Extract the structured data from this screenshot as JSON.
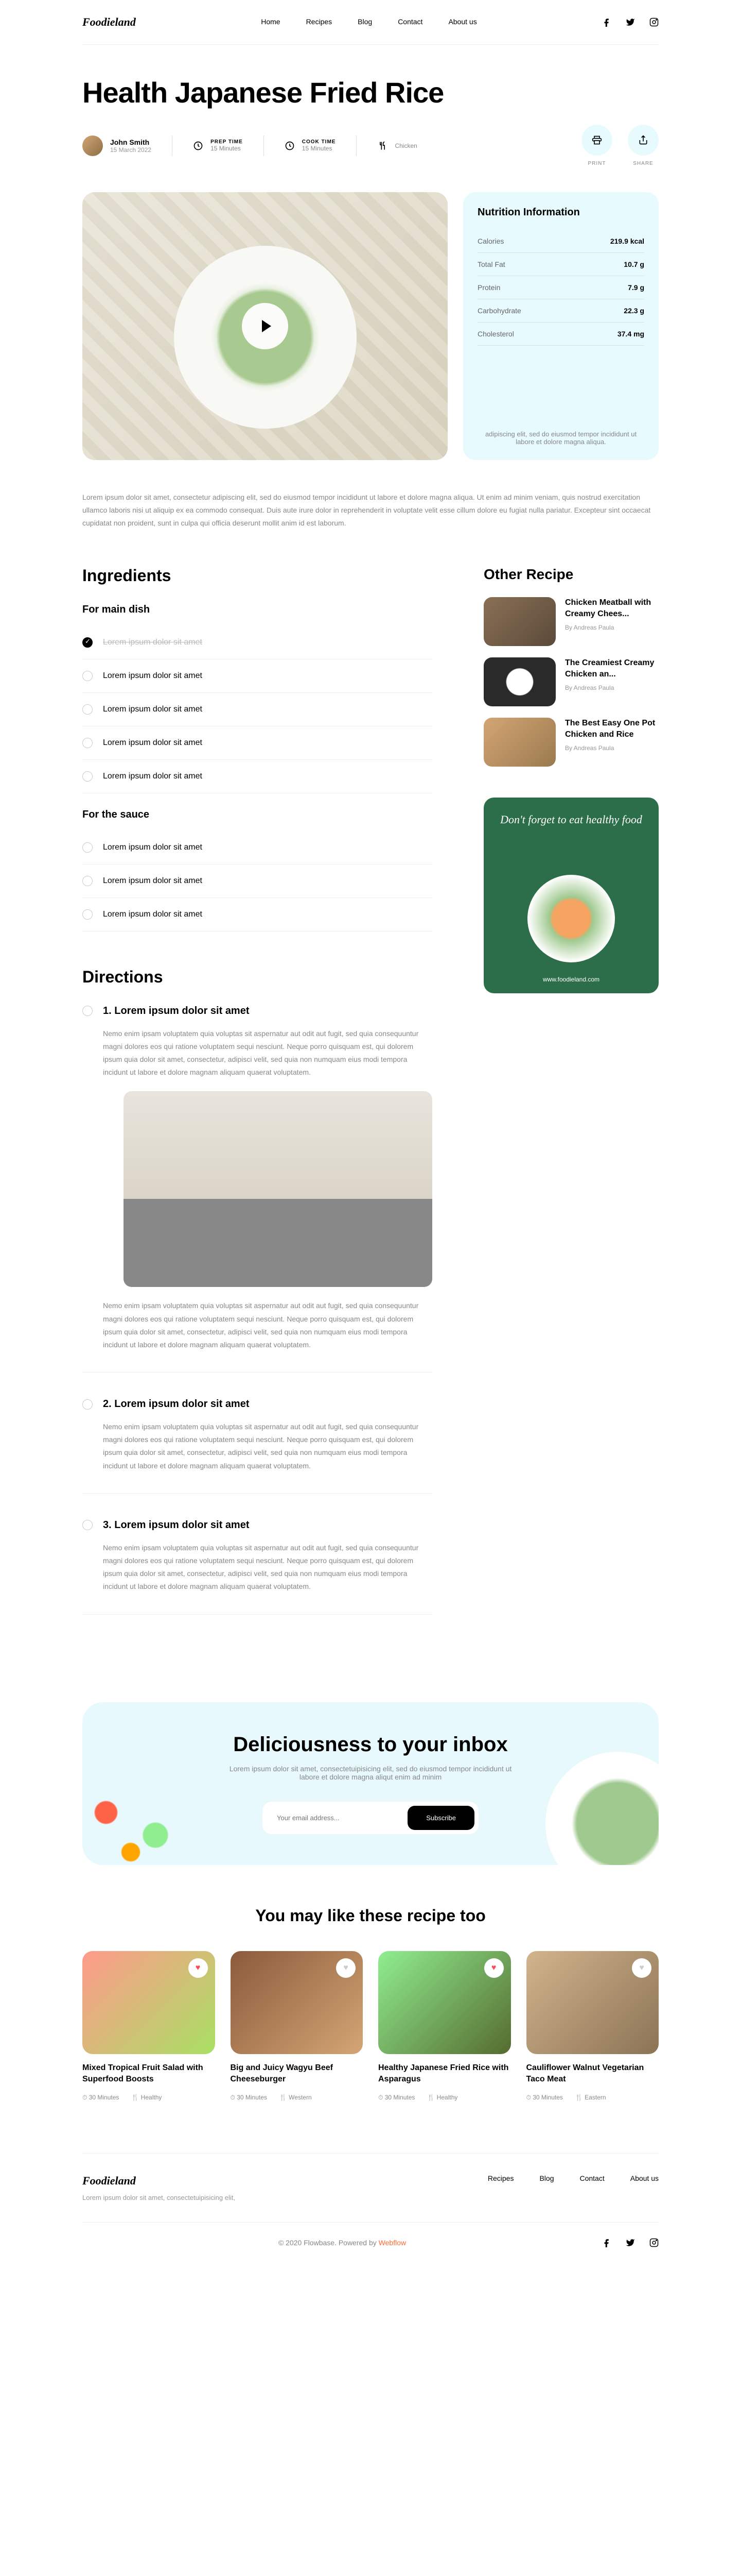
{
  "brand": "Foodieland",
  "nav": [
    "Home",
    "Recipes",
    "Blog",
    "Contact",
    "About us"
  ],
  "title": "Health Japanese Fried Rice",
  "author": {
    "name": "John Smith",
    "date": "15 March 2022"
  },
  "meta": {
    "prep": {
      "label": "PREP TIME",
      "value": "15 Minutes"
    },
    "cook": {
      "label": "COOK TIME",
      "value": "15 Minutes"
    },
    "category": "Chicken"
  },
  "actions": {
    "print": "PRINT",
    "share": "SHARE"
  },
  "nutrition": {
    "title": "Nutrition Information",
    "rows": [
      {
        "label": "Calories",
        "value": "219.9 kcal"
      },
      {
        "label": "Total Fat",
        "value": "10.7 g"
      },
      {
        "label": "Protein",
        "value": "7.9 g"
      },
      {
        "label": "Carbohydrate",
        "value": "22.3 g"
      },
      {
        "label": "Cholesterol",
        "value": "37.4 mg"
      }
    ],
    "note": "adipiscing elit, sed do eiusmod tempor incididunt ut labore et dolore magna aliqua."
  },
  "intro": "Lorem ipsum dolor sit amet, consectetur adipiscing elit, sed do eiusmod tempor incididunt ut labore et dolore magna aliqua. Ut enim ad minim veniam, quis nostrud exercitation ullamco laboris nisi ut aliquip ex ea commodo consequat. Duis aute irure dolor in reprehenderit in voluptate velit esse cillum dolore eu fugiat nulla pariatur. Excepteur sint occaecat cupidatat non proident, sunt in culpa qui officia deserunt mollit anim id est laborum.",
  "ingredients": {
    "heading": "Ingredients",
    "groups": [
      {
        "title": "For main dish",
        "items": [
          {
            "text": "Lorem ipsum dolor sit amet",
            "done": true
          },
          {
            "text": "Lorem ipsum dolor sit amet",
            "done": false
          },
          {
            "text": "Lorem ipsum dolor sit amet",
            "done": false
          },
          {
            "text": "Lorem ipsum dolor sit amet",
            "done": false
          },
          {
            "text": "Lorem ipsum dolor sit amet",
            "done": false
          }
        ]
      },
      {
        "title": "For the sauce",
        "items": [
          {
            "text": "Lorem ipsum dolor sit amet",
            "done": false
          },
          {
            "text": "Lorem ipsum dolor sit amet",
            "done": false
          },
          {
            "text": "Lorem ipsum dolor sit amet",
            "done": false
          }
        ]
      }
    ]
  },
  "directions": {
    "heading": "Directions",
    "steps": [
      {
        "num": "1.",
        "title": "Lorem ipsum dolor sit amet",
        "text": "Nemo enim ipsam voluptatem quia voluptas sit aspernatur aut odit aut fugit, sed quia consequuntur magni dolores eos qui ratione voluptatem sequi nesciunt. Neque porro quisquam est, qui dolorem ipsum quia dolor sit amet, consectetur, adipisci velit, sed quia non numquam eius modi tempora incidunt ut labore et dolore magnam aliquam quaerat voluptatem.",
        "image": true,
        "text2": "Nemo enim ipsam voluptatem quia voluptas sit aspernatur aut odit aut fugit, sed quia consequuntur magni dolores eos qui ratione voluptatem sequi nesciunt. Neque porro quisquam est, qui dolorem ipsum quia dolor sit amet, consectetur, adipisci velit, sed quia non numquam eius modi tempora incidunt ut labore et dolore magnam aliquam quaerat voluptatem."
      },
      {
        "num": "2.",
        "title": "Lorem ipsum dolor sit amet",
        "text": "Nemo enim ipsam voluptatem quia voluptas sit aspernatur aut odit aut fugit, sed quia consequuntur magni dolores eos qui ratione voluptatem sequi nesciunt. Neque porro quisquam est, qui dolorem ipsum quia dolor sit amet, consectetur, adipisci velit, sed quia non numquam eius modi tempora incidunt ut labore et dolore magnam aliquam quaerat voluptatem."
      },
      {
        "num": "3.",
        "title": "Lorem ipsum dolor sit amet",
        "text": "Nemo enim ipsam voluptatem quia voluptas sit aspernatur aut odit aut fugit, sed quia consequuntur magni dolores eos qui ratione voluptatem sequi nesciunt. Neque porro quisquam est, qui dolorem ipsum quia dolor sit amet, consectetur, adipisci velit, sed quia non numquam eius modi tempora incidunt ut labore et dolore magnam aliquam quaerat voluptatem."
      }
    ]
  },
  "sidebar": {
    "heading": "Other Recipe",
    "items": [
      {
        "title": "Chicken Meatball with Creamy Chees...",
        "author": "By Andreas Paula"
      },
      {
        "title": "The Creamiest Creamy Chicken an...",
        "author": "By Andreas Paula"
      },
      {
        "title": "The Best Easy One Pot Chicken and Rice",
        "author": "By Andreas Paula"
      }
    ],
    "promo": {
      "text": "Don't forget to eat healthy food",
      "url": "www.foodieland.com"
    }
  },
  "subscribe": {
    "heading": "Deliciousness to your inbox",
    "text": "Lorem ipsum dolor sit amet, consectetuipisicing elit, sed do eiusmod tempor incididunt ut labore et dolore magna aliqut enim ad minim",
    "placeholder": "Your email address...",
    "button": "Subscribe"
  },
  "suggest": {
    "heading": "You may like these recipe too",
    "cards": [
      {
        "title": "Mixed Tropical Fruit Salad with Superfood Boosts",
        "time": "30 Minutes",
        "cat": "Healthy",
        "liked": true
      },
      {
        "title": "Big and Juicy Wagyu Beef Cheeseburger",
        "time": "30 Minutes",
        "cat": "Western",
        "liked": false
      },
      {
        "title": "Healthy Japanese Fried Rice with Asparagus",
        "time": "30 Minutes",
        "cat": "Healthy",
        "liked": true
      },
      {
        "title": "Cauliflower Walnut Vegetarian Taco Meat",
        "time": "30 Minutes",
        "cat": "Eastern",
        "liked": false
      }
    ]
  },
  "footer": {
    "desc": "Lorem ipsum dolor sit amet, consectetuipisicing elit,",
    "nav": [
      "Recipes",
      "Blog",
      "Contact",
      "About us"
    ],
    "copyright": "© 2020 Flowbase. Powered by ",
    "brand": "Webflow"
  }
}
